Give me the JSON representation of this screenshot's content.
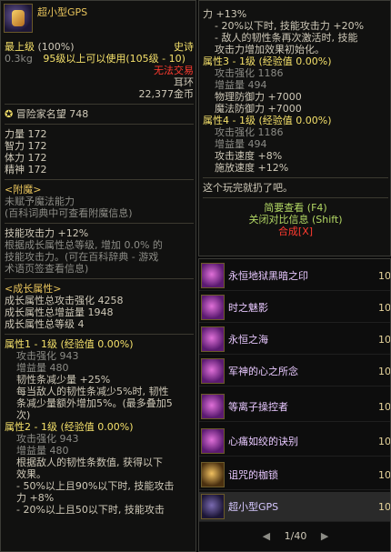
{
  "item": {
    "name": "超小型GPS",
    "max_level": "最上级",
    "max_level_pct": "(100%)",
    "rarity": "史诗",
    "weight": "0.3kg",
    "level_req": "95级以上可以使用(105级 - 10)",
    "trade": "无法交易",
    "slot": "耳环",
    "price": "22,377金币",
    "fame_label": "冒险家名望",
    "fame_value": "748",
    "stats": [
      {
        "name": "力量",
        "value": "172"
      },
      {
        "name": "智力",
        "value": "172"
      },
      {
        "name": "体力",
        "value": "172"
      },
      {
        "name": "精神",
        "value": "172"
      }
    ]
  },
  "enchant": {
    "header": "<附魔>",
    "line1": "未赋予魔法能力",
    "line2": "(百科词典中可查看附魔信息)"
  },
  "skill_atk": {
    "line1": "技能攻击力 +12%",
    "line2": "根据成长属性总等级, 增加 0.0% 的",
    "line3": "技能攻击力。(可在百科辞典 - 游戏",
    "line4": "术语页签查看信息)"
  },
  "growth": {
    "header": "<成长属性>",
    "atk": "成长属性总攻击强化 4258",
    "dmg": "成长属性总增益量 1948",
    "lvl": "成长属性总等级 4",
    "attr1": {
      "title": "属性1 - 1级 (经验值 0.00%)",
      "l1": "攻击强化 943",
      "l2": "增益量 480",
      "l3": "韧性条减少量 +25%",
      "l4": "每当敌人的韧性条减少5%时, 韧性",
      "l5": "条减少量额外增加5%。(最多叠加5",
      "l6": "次)"
    },
    "attr2": {
      "title": "属性2 - 1级 (经验值 0.00%)",
      "l1": "攻击强化 943",
      "l2": "增益量 480",
      "l3": "根据敌人的韧性条数值, 获得以下",
      "l4": "效果。",
      "l5": "- 50%以上且90%以下时, 技能攻击",
      "l6": "力 +8%",
      "l7": "- 20%以上且50以下时, 技能攻击"
    }
  },
  "right": {
    "r1": "力 +13%",
    "r2": "- 20%以下时, 技能攻击力 +20%",
    "r3": "- 敌人的韧性条再次激活时, 技能",
    "r4": "攻击力增加效果初始化。",
    "attr3": {
      "title": "属性3 - 1级 (经验值 0.00%)",
      "l1": "攻击强化 1186",
      "l2": "增益量 494",
      "l3": "物理防御力 +7000",
      "l4": "魔法防御力 +7000"
    },
    "attr4": {
      "title": "属性4 - 1级 (经验值 0.00%)",
      "l1": "攻击强化 1186",
      "l2": "增益量 494",
      "l3": "攻击速度 +8%",
      "l4": "施放速度 +12%"
    },
    "flavor": "这个玩完就扔了吧。",
    "brief": "简要查看 (F4)",
    "compare": "关闭对比信息 (Shift)",
    "synth": "合成[X]"
  },
  "list": {
    "items": [
      {
        "name": "永恒地狱黑暗之印",
        "level": "10"
      },
      {
        "name": "时之魅影",
        "level": "10"
      },
      {
        "name": "永恒之海",
        "level": "10"
      },
      {
        "name": "军神的心之所念",
        "level": "10"
      },
      {
        "name": "等离子操控者",
        "level": "10"
      },
      {
        "name": "心痛如绞的诀别",
        "level": "10"
      },
      {
        "name": "诅咒的枷锁",
        "level": "10"
      },
      {
        "name": "超小型GPS",
        "level": "10"
      }
    ],
    "page": "1/40"
  }
}
